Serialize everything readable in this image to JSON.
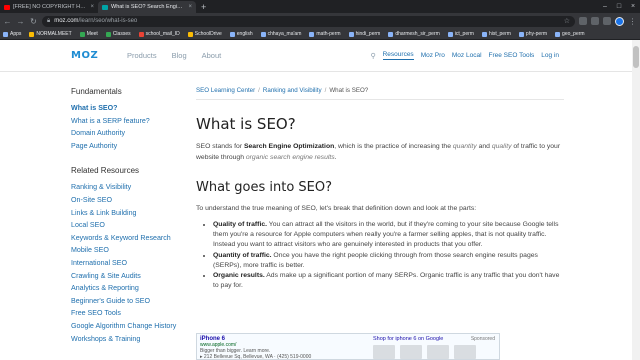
{
  "browser": {
    "tabs": [
      {
        "title": "[FREE] NO COPYRIGHT Hard",
        "favicon_color": "#ff0000"
      },
      {
        "title": "What is SEO? Search Engine Opt",
        "favicon_color": "#00a4a6"
      }
    ],
    "new_tab": "+",
    "url_host": "moz.com",
    "url_path": "/learn/seo/what-is-seo",
    "bookmarks": [
      {
        "label": "Apps",
        "icon": "apps-grid-icon"
      },
      {
        "label": "NORMALMEET",
        "icon": "bookmark-icon"
      },
      {
        "label": "Meet",
        "icon": "meet-icon"
      },
      {
        "label": "Classes",
        "icon": "classroom-icon"
      },
      {
        "label": "school_mail_ID",
        "icon": "mail-icon"
      },
      {
        "label": "SchoolDrive",
        "icon": "drive-icon"
      },
      {
        "label": "english",
        "icon": "bookmark-icon"
      },
      {
        "label": "chhaya_ma'am",
        "icon": "bookmark-icon"
      },
      {
        "label": "math-perm",
        "icon": "bookmark-icon"
      },
      {
        "label": "hindi_perm",
        "icon": "bookmark-icon"
      },
      {
        "label": "dharmesh_sir_perm",
        "icon": "bookmark-icon"
      },
      {
        "label": "ict_perm",
        "icon": "bookmark-icon"
      },
      {
        "label": "hist_perm",
        "icon": "bookmark-icon"
      },
      {
        "label": "phy-perm",
        "icon": "bookmark-icon"
      },
      {
        "label": "geo_perm",
        "icon": "bookmark-icon"
      }
    ]
  },
  "site": {
    "logo": "MOZ",
    "primary_nav": [
      "Products",
      "Blog",
      "About"
    ],
    "right_nav": {
      "resources": "Resources",
      "moz_pro": "Moz Pro",
      "moz_local": "Moz Local",
      "free_tools": "Free SEO Tools",
      "login": "Log in"
    }
  },
  "sidebar": {
    "fundamentals_heading": "Fundamentals",
    "fundamentals": [
      "What is SEO?",
      "What is a SERP feature?",
      "Domain Authority",
      "Page Authority"
    ],
    "related_heading": "Related Resources",
    "related": [
      "Ranking & Visibility",
      "On-Site SEO",
      "Links & Link Building",
      "Local SEO",
      "Keywords & Keyword Research",
      "Mobile SEO",
      "International SEO",
      "Crawling & Site Audits",
      "Analytics & Reporting",
      "Beginner's Guide to SEO",
      "Free SEO Tools",
      "Google Algorithm Change History",
      "Workshops & Training"
    ]
  },
  "content": {
    "breadcrumb": [
      "SEO Learning Center",
      "Ranking and Visibility",
      "What is SEO?"
    ],
    "title": "What is SEO?",
    "lead_prefix": "SEO stands for ",
    "lead_bold": "Search Engine Optimization",
    "lead_middle": ", which is the practice of increasing the ",
    "lead_em1": "quantity",
    "lead_and": " and ",
    "lead_em2": "quality",
    "lead_after": " of traffic to your website through ",
    "lead_em3": "organic search engine results",
    "lead_end": ".",
    "subtitle": "What goes into SEO?",
    "intro": "To understand the true meaning of SEO, let's break that definition down and look at the parts:",
    "bullets": [
      {
        "bold": "Quality of traffic.",
        "text": " You can attract all the visitors in the world, but if they're coming to your site because Google tells them you're a resource for Apple computers when really you're a farmer selling apples, that is not quality traffic. Instead you want to attract visitors who are genuinely interested in products that you offer."
      },
      {
        "bold": "Quantity of traffic.",
        "text": " Once you have the right people clicking through from those search engine results pages (SERPs), more traffic is better."
      },
      {
        "bold": "Organic results.",
        "text": " Ads make up a significant portion of many SERPs. Organic traffic is any traffic that you don't have to pay for."
      }
    ],
    "serp_image": {
      "result_title": "iPhone 6",
      "result_url": "www.apple.com/",
      "result_line1": "Bigger than bigger. Learn more.",
      "result_line2": "▸ 212 Bellevue Sq, Bellevue, WA · (425) 519-0000",
      "shop_label": "Shop for iphone 6 on Google",
      "sponsored": "Sponsored"
    }
  }
}
